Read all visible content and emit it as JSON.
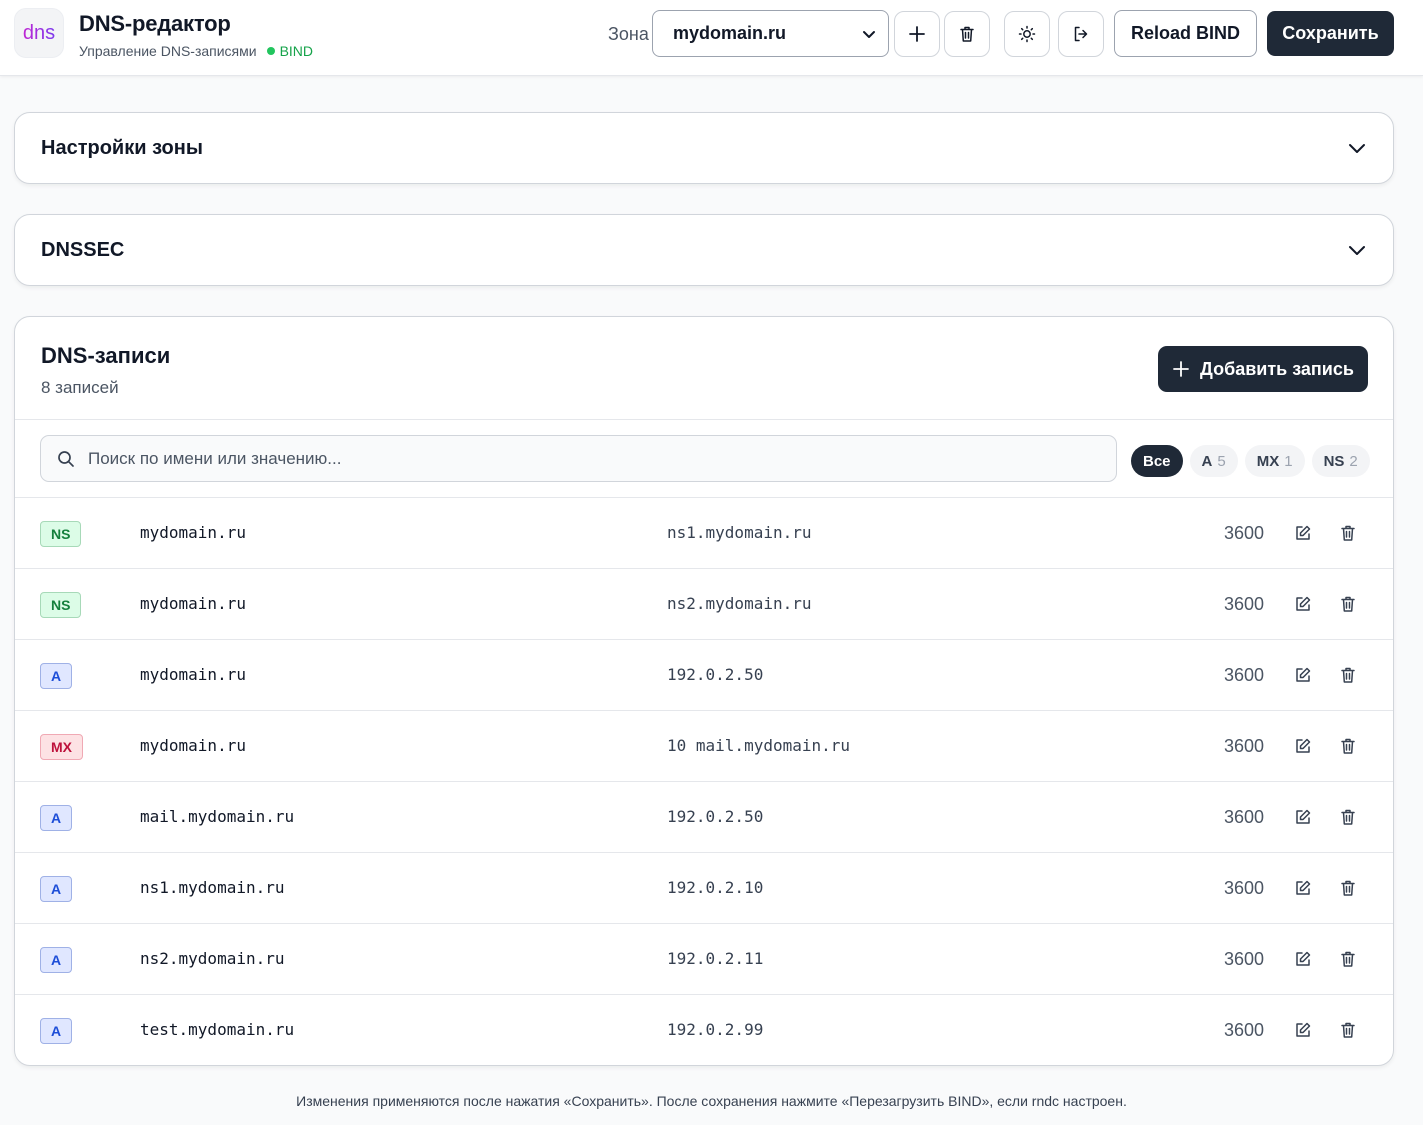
{
  "app": {
    "logo_text": "dns",
    "title": "DNS-редактор",
    "subtitle": "Управление DNS-записями",
    "status": "BIND"
  },
  "toolbar": {
    "zone_label": "Зона",
    "zone_selected": "mydomain.ru",
    "reload_label": "Reload BIND",
    "save_label": "Сохранить"
  },
  "sections": {
    "zone_settings": "Настройки зоны",
    "dnssec": "DNSSEC"
  },
  "records": {
    "title": "DNS-записи",
    "count_label": "8 записей",
    "add_label": "Добавить запись",
    "search_placeholder": "Поиск по имени или значению...",
    "filters": [
      {
        "label": "Все",
        "count": ""
      },
      {
        "label": "A",
        "count": "5"
      },
      {
        "label": "MX",
        "count": "1"
      },
      {
        "label": "NS",
        "count": "2"
      }
    ],
    "items": [
      {
        "type": "NS",
        "name": "mydomain.ru",
        "value": "ns1.mydomain.ru",
        "ttl": "3600"
      },
      {
        "type": "NS",
        "name": "mydomain.ru",
        "value": "ns2.mydomain.ru",
        "ttl": "3600"
      },
      {
        "type": "A",
        "name": "mydomain.ru",
        "value": "192.0.2.50",
        "ttl": "3600"
      },
      {
        "type": "MX",
        "name": "mydomain.ru",
        "value": "10 mail.mydomain.ru",
        "ttl": "3600"
      },
      {
        "type": "A",
        "name": "mail.mydomain.ru",
        "value": "192.0.2.50",
        "ttl": "3600"
      },
      {
        "type": "A",
        "name": "ns1.mydomain.ru",
        "value": "192.0.2.10",
        "ttl": "3600"
      },
      {
        "type": "A",
        "name": "ns2.mydomain.ru",
        "value": "192.0.2.11",
        "ttl": "3600"
      },
      {
        "type": "A",
        "name": "test.mydomain.ru",
        "value": "192.0.2.99",
        "ttl": "3600"
      }
    ]
  },
  "footer": "Изменения применяются после нажатия «Сохранить». После сохранения нажмите «Перезагрузить BIND», если rndc настроен.",
  "colors": {
    "accent_dark": "#1f2937",
    "status_green": "#22c55e",
    "logo_purple": "#8b5cf6"
  }
}
